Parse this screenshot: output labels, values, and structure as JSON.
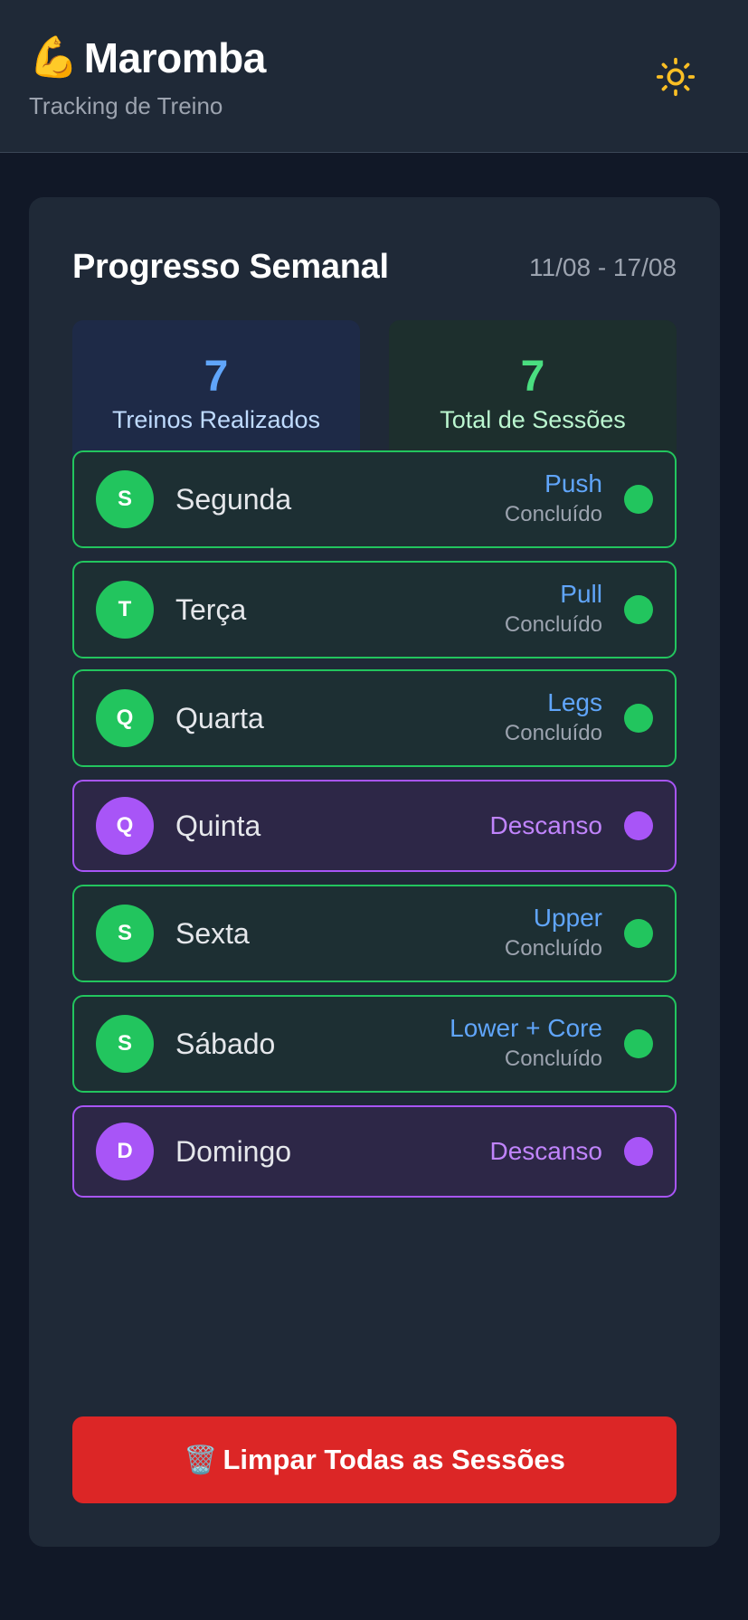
{
  "header": {
    "brand_emoji": "💪",
    "title": "Maromba",
    "subtitle": "Tracking de Treino",
    "theme_icon": "sun-icon"
  },
  "weekly": {
    "title": "Progresso Semanal",
    "range": "11/08 - 17/08",
    "stats": [
      {
        "value": "7",
        "label": "Treinos Realizados",
        "color": "#60a5fa"
      },
      {
        "value": "7",
        "label": "Total de Sessões",
        "color": "#4ade80"
      }
    ],
    "days": [
      {
        "initial": "S",
        "name": "Segunda",
        "workout": "Push",
        "status": "Concluído",
        "type": "done"
      },
      {
        "initial": "T",
        "name": "Terça",
        "workout": "Pull",
        "status": "Concluído",
        "type": "done"
      },
      {
        "initial": "Q",
        "name": "Quarta",
        "workout": "Legs",
        "status": "Concluído",
        "type": "done"
      },
      {
        "initial": "Q",
        "name": "Quinta",
        "workout": "Descanso",
        "status": "",
        "type": "rest"
      },
      {
        "initial": "S",
        "name": "Sexta",
        "workout": "Upper",
        "status": "Concluído",
        "type": "done"
      },
      {
        "initial": "S",
        "name": "Sábado",
        "workout": "Lower + Core",
        "status": "Concluído",
        "type": "done"
      },
      {
        "initial": "D",
        "name": "Domingo",
        "workout": "Descanso",
        "status": "",
        "type": "rest"
      }
    ]
  },
  "actions": {
    "clear_icon": "🗑️",
    "clear_label": "Limpar Todas as Sessões"
  },
  "colors": {
    "done": "#22c55e",
    "rest": "#a855f7",
    "danger": "#dc2626",
    "accent_blue": "#60a5fa"
  }
}
